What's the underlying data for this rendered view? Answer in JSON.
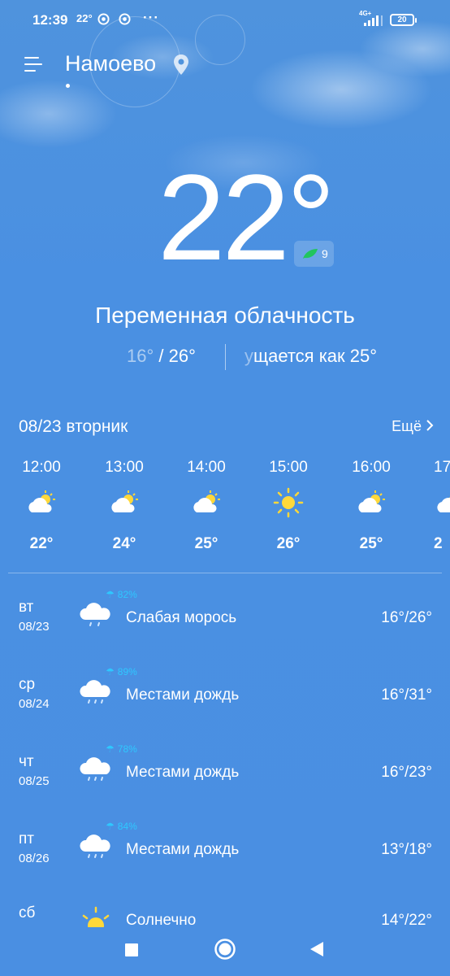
{
  "status_bar": {
    "time": "12:39",
    "temp": "22°",
    "dots": "···",
    "network": "4G+",
    "battery": "20"
  },
  "header": {
    "city": "Намоево"
  },
  "current": {
    "temp": "22°",
    "aqi": "9",
    "condition": "Переменная облачность",
    "range_low": "16°",
    "range_high": " / 26°",
    "feels_fade": "у",
    "feels": "щается как 25°"
  },
  "hourly": {
    "day_label": "08/23 вторник",
    "more_label": "Ещё",
    "items": [
      {
        "time": "12:00",
        "temp": "22°",
        "icon": "partly-cloudy-icon"
      },
      {
        "time": "13:00",
        "temp": "24°",
        "icon": "partly-cloudy-icon"
      },
      {
        "time": "14:00",
        "temp": "25°",
        "icon": "partly-cloudy-icon"
      },
      {
        "time": "15:00",
        "temp": "26°",
        "icon": "sun-icon"
      },
      {
        "time": "16:00",
        "temp": "25°",
        "icon": "partly-cloudy-icon"
      },
      {
        "time": "17",
        "temp": "2",
        "icon": "partly-cloudy-icon"
      }
    ]
  },
  "daily": [
    {
      "dow": "вт",
      "date": "08/23",
      "precip": "82%",
      "desc": "Слабая морось",
      "range": "16°/26°",
      "icon": "drizzle-cloud-icon"
    },
    {
      "dow": "ср",
      "date": "08/24",
      "precip": "89%",
      "desc": "Местами дождь",
      "range": "16°/31°",
      "icon": "rain-cloud-icon"
    },
    {
      "dow": "чт",
      "date": "08/25",
      "precip": "78%",
      "desc": "Местами дождь",
      "range": "16°/23°",
      "icon": "rain-cloud-icon"
    },
    {
      "dow": "пт",
      "date": "08/26",
      "precip": "84%",
      "desc": "Местами дождь",
      "range": "13°/18°",
      "icon": "rain-cloud-icon"
    },
    {
      "dow": "сб",
      "date": "",
      "precip": "",
      "desc": "Солнечно",
      "range": "14°/22°",
      "icon": "sun-icon"
    }
  ],
  "colors": {
    "background": "#4a90e2",
    "precip": "#2ec8ff",
    "sun": "#ffd83a",
    "aqi_leaf": "#22c55e"
  }
}
